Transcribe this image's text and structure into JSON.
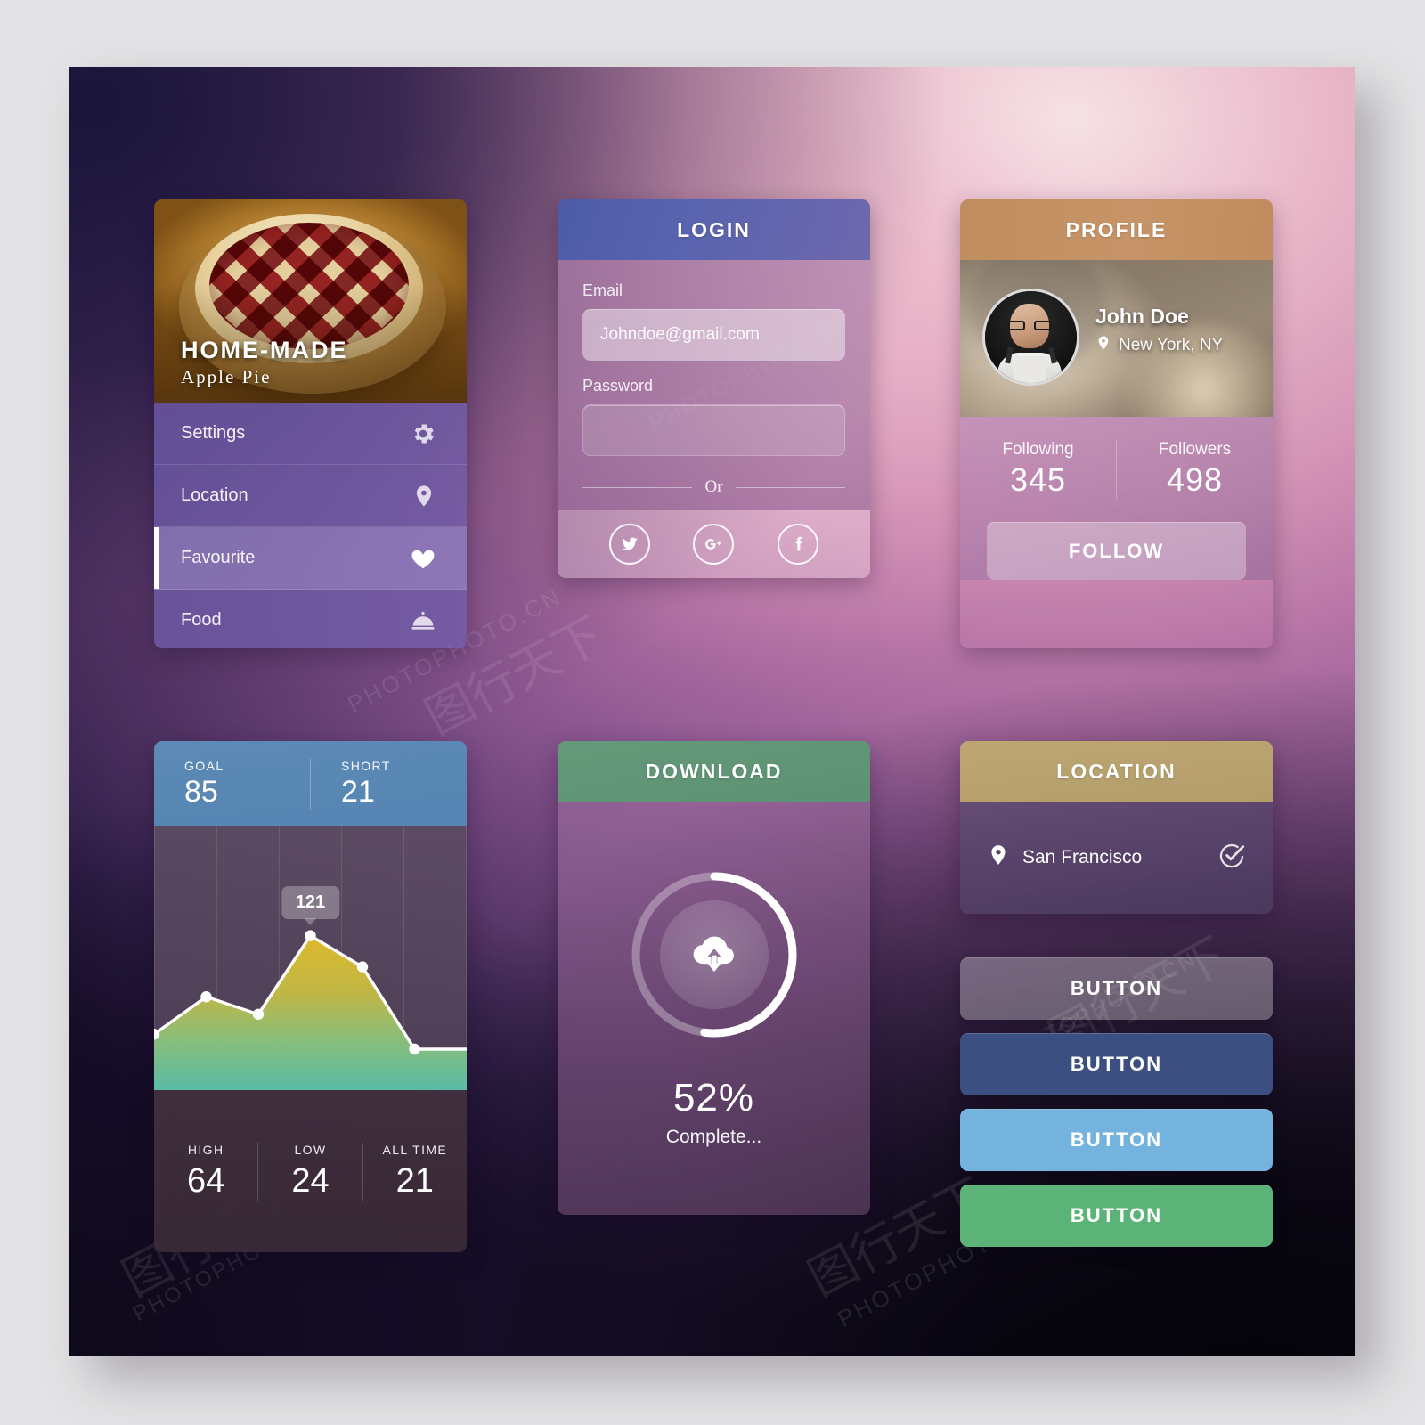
{
  "menu_card": {
    "photo": {
      "title": "HOME-MADE",
      "subtitle": "Apple Pie",
      "image_name": "apple-pie-photo"
    },
    "items": [
      {
        "label": "Settings",
        "icon": "gear-icon",
        "active": false
      },
      {
        "label": "Location",
        "icon": "map-pin-icon",
        "active": false
      },
      {
        "label": "Favourite",
        "icon": "heart-icon",
        "active": true
      },
      {
        "label": "Food",
        "icon": "food-cloche-icon",
        "active": false
      }
    ]
  },
  "login_card": {
    "header": "LOGIN",
    "header_color": "#5a64ae",
    "email": {
      "label": "Email",
      "value": "Johndoe@gmail.com",
      "placeholder": "Johndoe@gmail.com"
    },
    "password": {
      "label": "Password",
      "value": "",
      "placeholder": ""
    },
    "divider_text": "Or",
    "social": [
      {
        "name": "twitter-icon",
        "glyph": "twitter"
      },
      {
        "name": "google-plus-icon",
        "glyph": "g+"
      },
      {
        "name": "facebook-icon",
        "glyph": "f"
      }
    ]
  },
  "profile_card": {
    "header": "PROFILE",
    "header_color": "#c4916a",
    "name": "John Doe",
    "location": "New York, NY",
    "stats": [
      {
        "label": "Following",
        "value": "345"
      },
      {
        "label": "Followers",
        "value": "498"
      }
    ],
    "follow_button": "FOLLOW"
  },
  "chart_card": {
    "top_stats": [
      {
        "label": "GOAL",
        "value": "85"
      },
      {
        "label": "SHORT",
        "value": "21"
      }
    ],
    "bottom_stats": [
      {
        "label": "HIGH",
        "value": "64"
      },
      {
        "label": "LOW",
        "value": "24"
      },
      {
        "label": "ALL TIME",
        "value": "21"
      }
    ],
    "tooltip": "121",
    "header_color": "#5c8cb8"
  },
  "chart_data": {
    "type": "area",
    "title": "",
    "xlabel": "",
    "ylabel": "",
    "x": [
      0,
      1,
      2,
      3,
      4,
      5,
      6
    ],
    "values": [
      42,
      72,
      58,
      121,
      96,
      30,
      30
    ],
    "highlight_index": 3,
    "highlight_label": "121",
    "ylim": [
      0,
      140
    ],
    "grid": true,
    "legend": "none",
    "point_markers": true,
    "area_gradient": [
      "#e0bb35",
      "#5fc3a8"
    ],
    "line_color": "#ffffff"
  },
  "download_card": {
    "header": "DOWNLOAD",
    "header_color": "#5f9476",
    "percent_label": "52%",
    "percent_value": 52,
    "status": "Complete...",
    "icon": "cloud-download-icon"
  },
  "location_card": {
    "header": "LOCATION",
    "header_color": "#b8a071",
    "place": "San Francisco",
    "pin_icon": "map-pin-icon",
    "check_icon": "check-circle-icon"
  },
  "buttons": [
    {
      "label": "BUTTON",
      "color": "rgba(255,255,255,0.30)",
      "hex": "#b0a8ad"
    },
    {
      "label": "BUTTON",
      "color": "#3b4f80",
      "hex": "#3b4f80"
    },
    {
      "label": "BUTTON",
      "color": "#74b3dd",
      "hex": "#74b3dd"
    },
    {
      "label": "BUTTON",
      "color": "#5cb378",
      "hex": "#5cb378"
    }
  ],
  "watermarks": {
    "text_en": "PHOTOPHOTO.CN",
    "text_cn": "图行天下"
  }
}
